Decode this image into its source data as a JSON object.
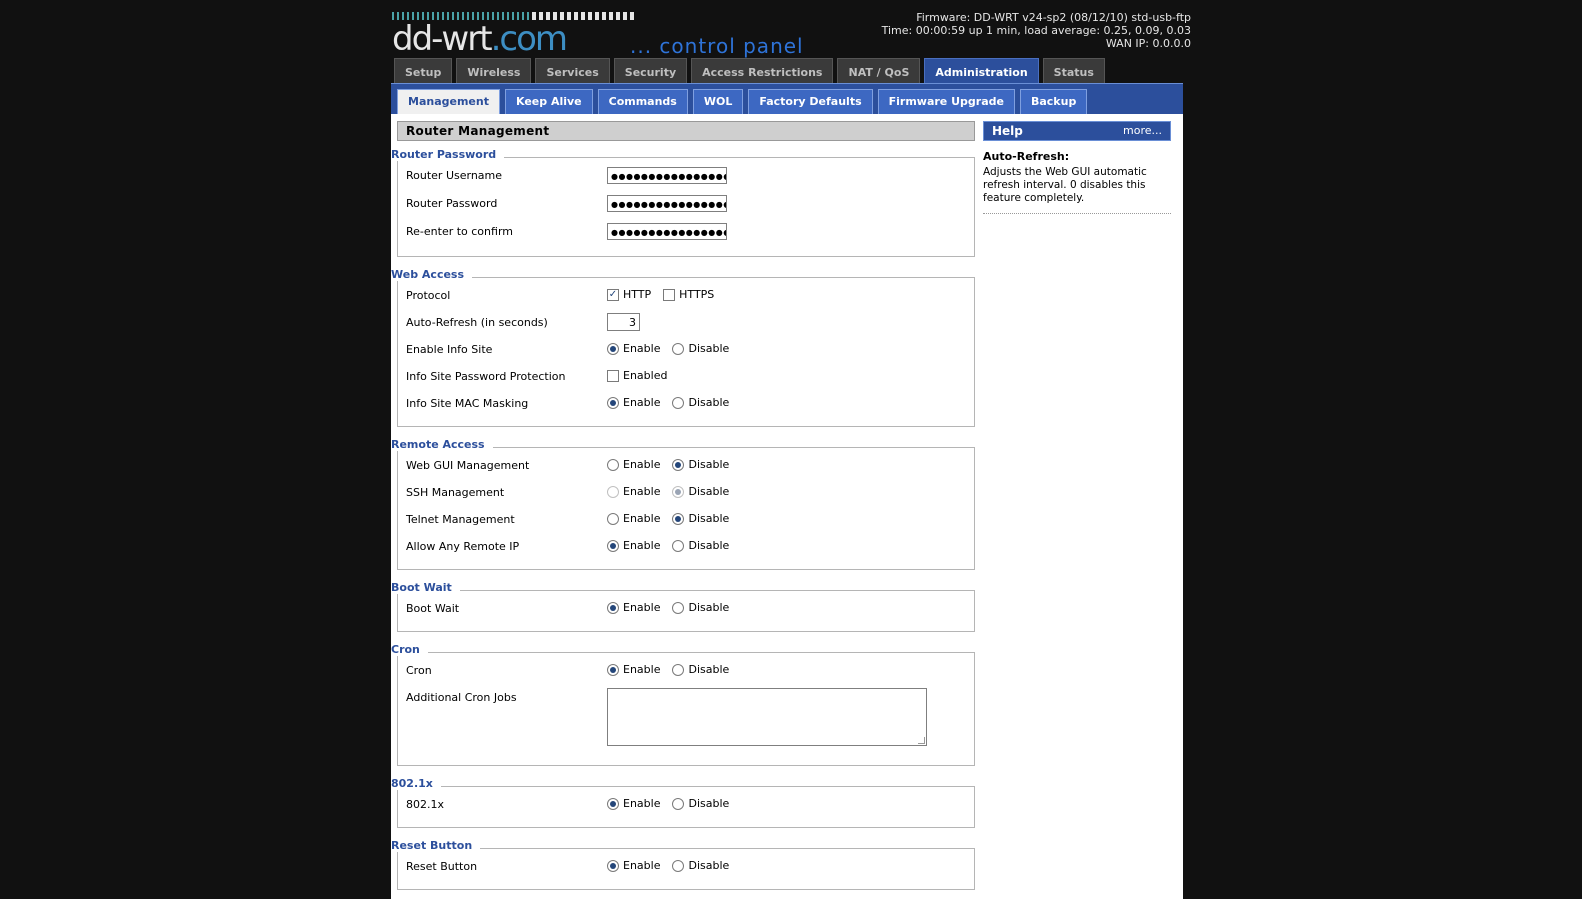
{
  "brand": {
    "logo_text": "dd-wrt",
    "logo_domain": ".com",
    "tagline": "... control panel"
  },
  "status": {
    "firmware": "Firmware: DD-WRT v24-sp2 (08/12/10) std-usb-ftp",
    "time": "Time: 00:00:59 up 1 min, load average: 0.25, 0.09, 0.03",
    "wan_ip": "WAN IP: 0.0.0.0"
  },
  "tabs": [
    "Setup",
    "Wireless",
    "Services",
    "Security",
    "Access Restrictions",
    "NAT / QoS",
    "Administration",
    "Status"
  ],
  "subtabs": [
    "Management",
    "Keep Alive",
    "Commands",
    "WOL",
    "Factory Defaults",
    "Firmware Upgrade",
    "Backup"
  ],
  "main": {
    "title": "Router Management",
    "router_password": {
      "legend": "Router Password",
      "username_label": "Router Username",
      "password_label": "Router Password",
      "confirm_label": "Re-enter to confirm",
      "masked_value": "●●●●●●●●●●●●●●●●"
    },
    "web_access": {
      "legend": "Web Access",
      "protocol_label": "Protocol",
      "http": "HTTP",
      "https": "HTTPS",
      "http_checked": true,
      "https_checked": false,
      "refresh_label": "Auto-Refresh (in seconds)",
      "refresh_value": "3",
      "info_site_label": "Enable Info Site",
      "info_pw_label": "Info Site Password Protection",
      "info_pw_option": "Enabled",
      "info_mac_label": "Info Site MAC Masking"
    },
    "remote_access": {
      "legend": "Remote Access",
      "gui_label": "Web GUI Management",
      "ssh_label": "SSH Management",
      "telnet_label": "Telnet Management",
      "any_ip_label": "Allow Any Remote IP"
    },
    "boot_wait": {
      "legend": "Boot Wait",
      "label": "Boot Wait"
    },
    "cron": {
      "legend": "Cron",
      "label": "Cron",
      "jobs_label": "Additional Cron Jobs",
      "jobs_value": ""
    },
    "dot1x": {
      "legend": "802.1x",
      "label": "802.1x"
    },
    "reset": {
      "legend": "Reset Button",
      "label": "Reset Button"
    },
    "enable": "Enable",
    "disable": "Disable"
  },
  "help": {
    "title": "Help",
    "more": "more...",
    "topic": "Auto-Refresh:",
    "text": "Adjusts the Web GUI automatic refresh interval. 0 disables this feature completely."
  }
}
